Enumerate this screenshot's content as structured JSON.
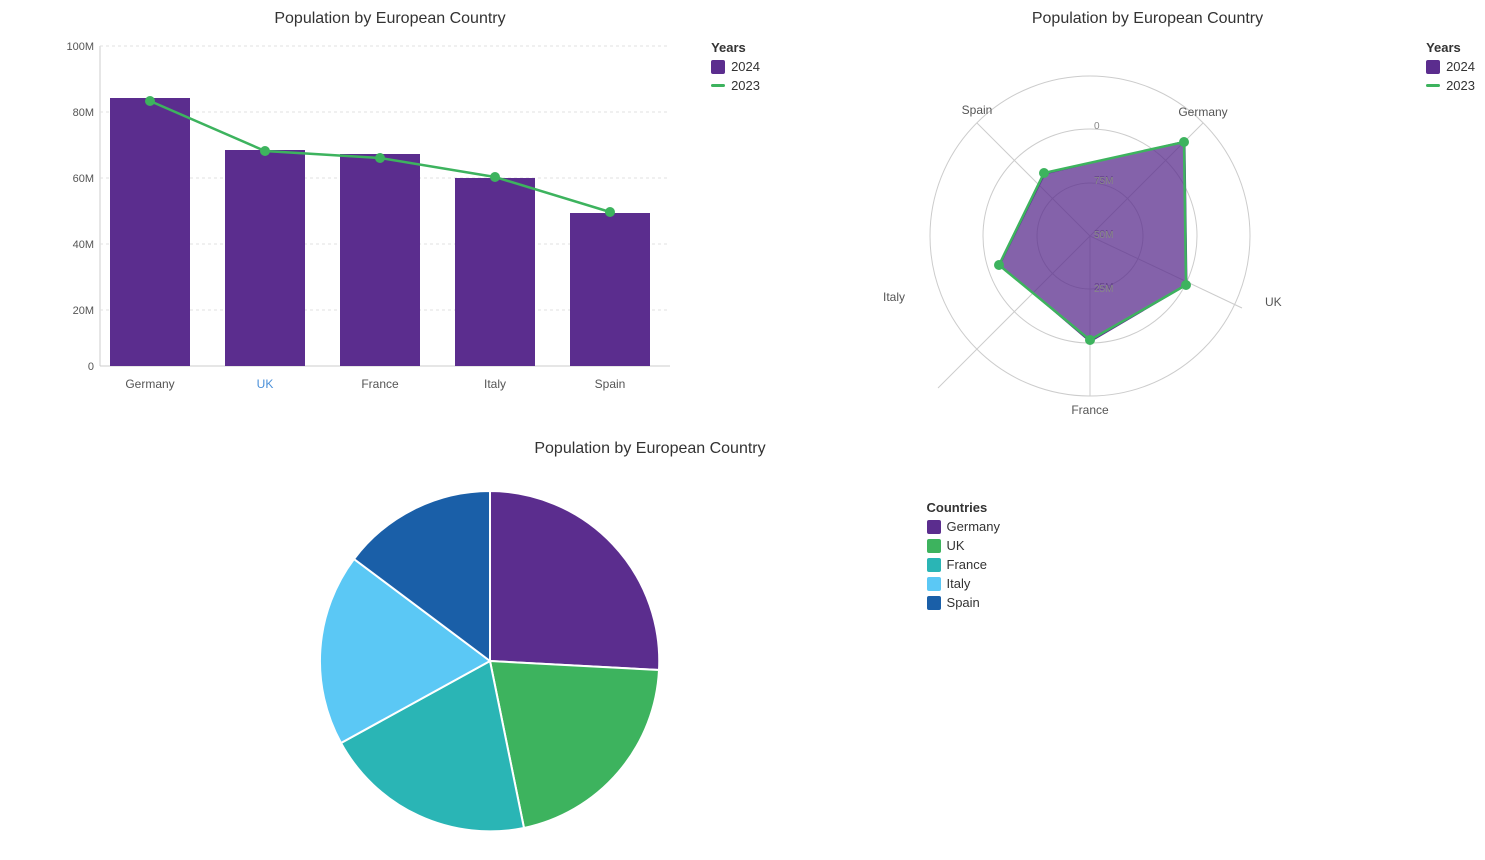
{
  "charts": {
    "bar": {
      "title": "Population by European Country",
      "countries": [
        "Germany",
        "UK",
        "France",
        "Italy",
        "Spain"
      ],
      "values2024": [
        84,
        68,
        66,
        59,
        48
      ],
      "values2023": [
        83,
        67.5,
        65,
        59.5,
        48.5
      ],
      "yLabels": [
        "0",
        "20M",
        "40M",
        "60M",
        "80M",
        "100M"
      ],
      "legend": {
        "title": "Years",
        "items": [
          {
            "label": "2024",
            "color": "#5b2d8e",
            "type": "bar"
          },
          {
            "label": "2023",
            "color": "#3db35e",
            "type": "line"
          }
        ]
      }
    },
    "radar": {
      "title": "Population by European Country",
      "countries": [
        "Germany",
        "UK",
        "France",
        "Italy",
        "Spain"
      ],
      "values2024": [
        84,
        68,
        66,
        59,
        48
      ],
      "values2023": [
        83,
        67.5,
        65,
        59.5,
        48.5
      ],
      "rings": [
        "25M",
        "50M",
        "75M"
      ],
      "legend": {
        "title": "Years",
        "items": [
          {
            "label": "2024",
            "color": "#5b2d8e",
            "type": "bar"
          },
          {
            "label": "2023",
            "color": "#3db35e",
            "type": "line"
          }
        ]
      }
    },
    "pie": {
      "title": "Population by European Country",
      "segments": [
        {
          "country": "Germany",
          "value": 84,
          "color": "#5b2d8e",
          "startAngle": 90
        },
        {
          "country": "UK",
          "value": 68,
          "color": "#3db35e"
        },
        {
          "country": "France",
          "value": 66,
          "color": "#2ab5b5"
        },
        {
          "country": "Italy",
          "value": 59,
          "color": "#5bc8f5"
        },
        {
          "country": "Spain",
          "value": 48,
          "color": "#1a5fa8"
        }
      ],
      "legend": {
        "title": "Countries",
        "items": [
          {
            "label": "Germany",
            "color": "#5b2d8e"
          },
          {
            "label": "UK",
            "color": "#3db35e"
          },
          {
            "label": "France",
            "color": "#2ab5b5"
          },
          {
            "label": "Italy",
            "color": "#5bc8f5"
          },
          {
            "label": "Spain",
            "color": "#1a5fa8"
          }
        ]
      }
    }
  }
}
